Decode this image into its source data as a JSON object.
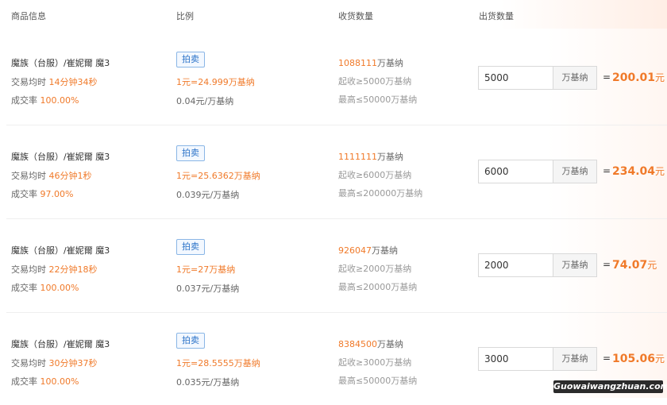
{
  "headers": {
    "item": "商品信息",
    "ratio": "比例",
    "receive": "收货数量",
    "ship": "出货数量"
  },
  "rows": [
    {
      "title": "魔族（台服）/崔妮爾 魔3",
      "time_label": "交易均时",
      "time_value": "14分钟34秒",
      "rate_label": "成交率",
      "rate_value": "100.00%",
      "tag": "拍卖",
      "ratio": "1元=24.999万基纳",
      "unit_price": "0.04元/万基纳",
      "recv_qty": "1088111",
      "recv_unit": "万基纳",
      "min": "起收≥5000万基纳",
      "max": "最高≤50000万基纳",
      "qty": "5000",
      "qty_unit": "万基纳",
      "eq": "=",
      "total": "200.01",
      "yuan": "元"
    },
    {
      "title": "魔族（台服）/崔妮爾 魔3",
      "time_label": "交易均时",
      "time_value": "46分钟1秒",
      "rate_label": "成交率",
      "rate_value": "97.00%",
      "tag": "拍卖",
      "ratio": "1元=25.6362万基纳",
      "unit_price": "0.039元/万基纳",
      "recv_qty": "1111111",
      "recv_unit": "万基纳",
      "min": "起收≥6000万基纳",
      "max": "最高≤200000万基纳",
      "qty": "6000",
      "qty_unit": "万基纳",
      "eq": "=",
      "total": "234.04",
      "yuan": "元"
    },
    {
      "title": "魔族（台服）/崔妮爾 魔3",
      "time_label": "交易均时",
      "time_value": "22分钟18秒",
      "rate_label": "成交率",
      "rate_value": "100.00%",
      "tag": "拍卖",
      "ratio": "1元=27万基纳",
      "unit_price": "0.037元/万基纳",
      "recv_qty": "926047",
      "recv_unit": "万基纳",
      "min": "起收≥2000万基纳",
      "max": "最高≤20000万基纳",
      "qty": "2000",
      "qty_unit": "万基纳",
      "eq": "=",
      "total": "74.07",
      "yuan": "元"
    },
    {
      "title": "魔族（台服）/崔妮爾 魔3",
      "time_label": "交易均时",
      "time_value": "30分钟37秒",
      "rate_label": "成交率",
      "rate_value": "100.00%",
      "tag": "拍卖",
      "ratio": "1元=28.5555万基纳",
      "unit_price": "0.035元/万基纳",
      "recv_qty": "8384500",
      "recv_unit": "万基纳",
      "min": "起收≥3000万基纳",
      "max": "最高≤50000万基纳",
      "qty": "3000",
      "qty_unit": "万基纳",
      "eq": "=",
      "total": "105.06",
      "yuan": "元"
    }
  ],
  "watermark": "Guowaiwangzhuan.com",
  "colors": {
    "accent": "#f07a2a",
    "tag_blue": "#2a72c8",
    "tag_border": "#8ab6e6"
  }
}
